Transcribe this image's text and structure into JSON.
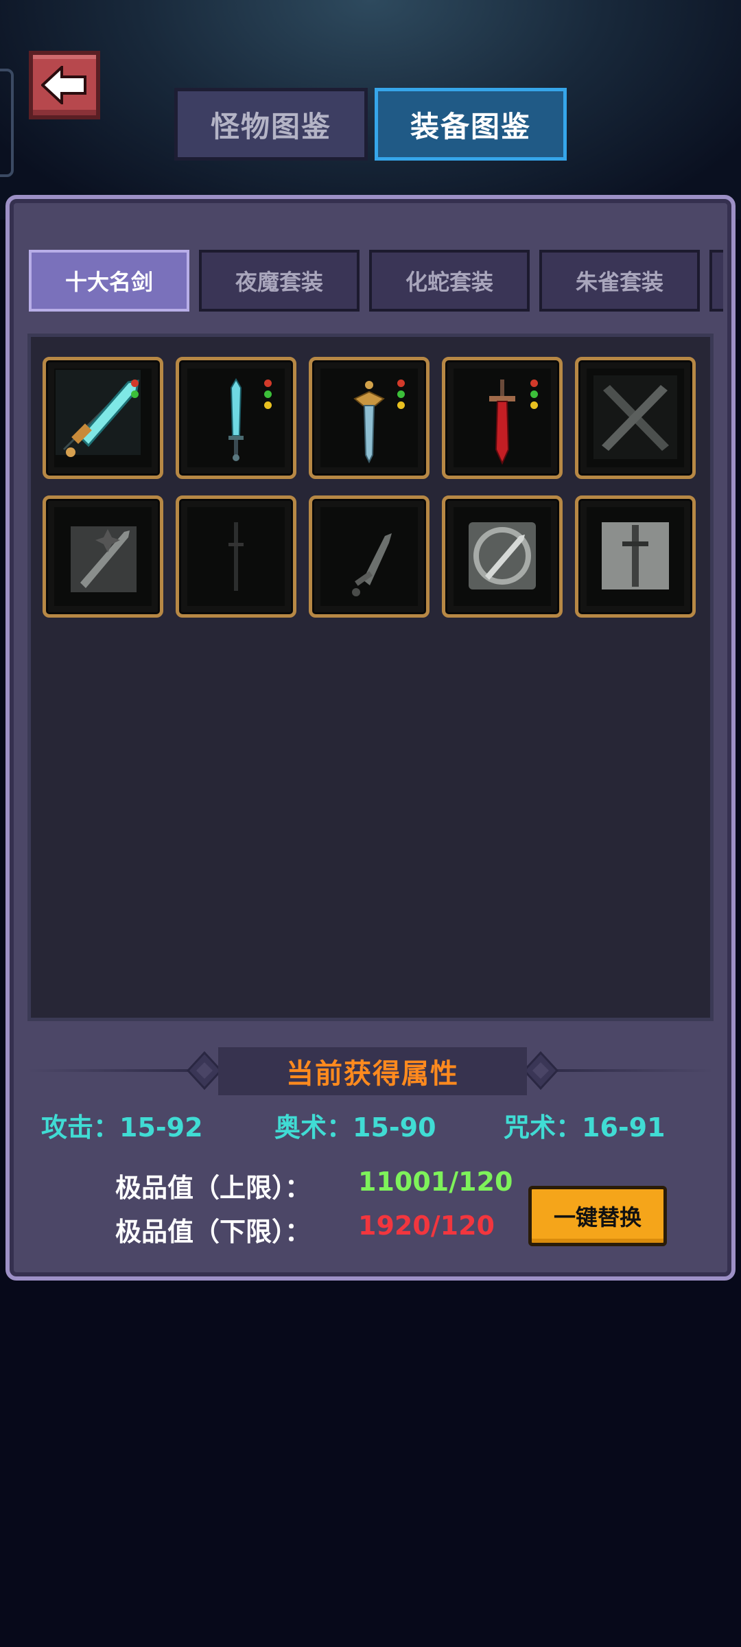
{
  "header": {
    "back_icon": "back-arrow-icon",
    "tabs": [
      {
        "label": "怪物图鉴",
        "active": false
      },
      {
        "label": "装备图鉴",
        "active": true
      }
    ]
  },
  "categories": [
    {
      "label": "十大名剑",
      "active": true
    },
    {
      "label": "夜魔套装",
      "active": false
    },
    {
      "label": "化蛇套装",
      "active": false
    },
    {
      "label": "朱雀套装",
      "active": false
    }
  ],
  "items": [
    {
      "icon": "crystal-sword-icon",
      "quality_dots": [
        "#d23a2a",
        "#3cbf3a"
      ]
    },
    {
      "icon": "ice-sword-icon",
      "quality_dots": [
        "#d23a2a",
        "#3cbf3a",
        "#e8c020"
      ]
    },
    {
      "icon": "golden-hilt-sword-icon",
      "quality_dots": [
        "#d23a2a",
        "#3cbf3a",
        "#e8c020"
      ]
    },
    {
      "icon": "crimson-sword-icon",
      "quality_dots": [
        "#d23a2a",
        "#3cbf3a",
        "#e8c020"
      ]
    },
    {
      "icon": "crossed-swords-icon",
      "quality_dots": []
    },
    {
      "icon": "dark-spiked-sword-icon",
      "quality_dots": []
    },
    {
      "icon": "shadow-sword-icon",
      "quality_dots": []
    },
    {
      "icon": "broad-sword-icon",
      "quality_dots": []
    },
    {
      "icon": "serpent-sword-icon",
      "quality_dots": []
    },
    {
      "icon": "silver-greatsword-icon",
      "quality_dots": []
    }
  ],
  "attributes": {
    "title": "当前获得属性",
    "stats": [
      {
        "label": "攻击：",
        "value": "15-92"
      },
      {
        "label": "奥术：",
        "value": "15-90"
      },
      {
        "label": "咒术：",
        "value": "16-91"
      }
    ],
    "quality_upper": {
      "label": "极品值（上限）：",
      "value": "11001/120",
      "color": "#7ef25a"
    },
    "quality_lower": {
      "label": "极品值（下限）：",
      "value": "1920/120",
      "color": "#f2363e"
    },
    "replace_button": "一键替换"
  }
}
